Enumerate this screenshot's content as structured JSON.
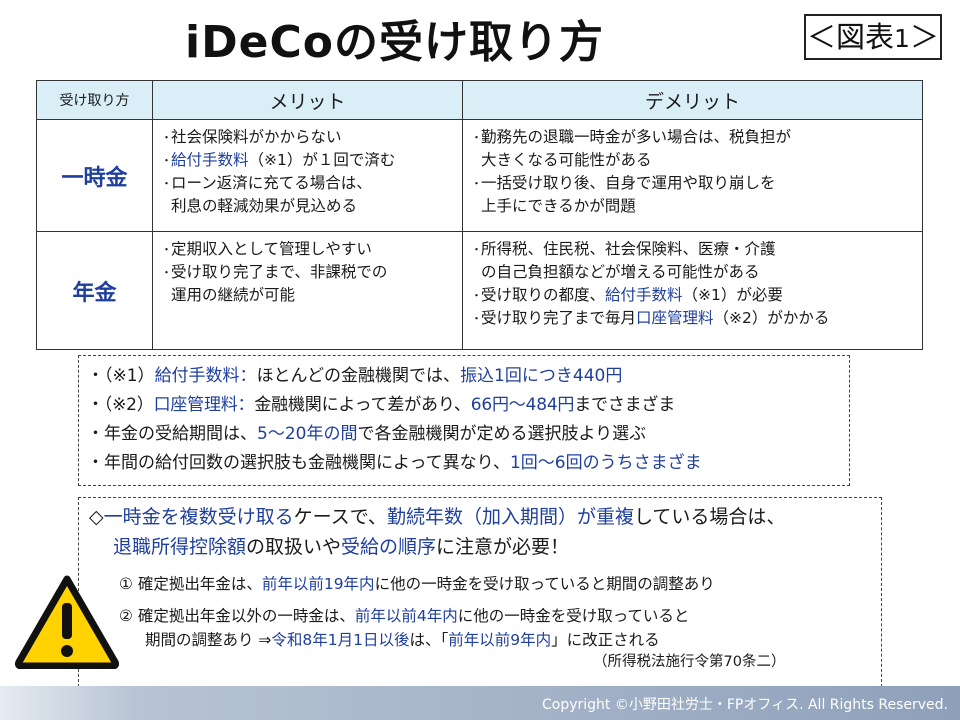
{
  "title": "iDeCoの受け取り方",
  "figure_label": {
    "open": "＜図表",
    "num": "1",
    "close": "＞"
  },
  "table": {
    "headers": [
      "受け取り方",
      "メリット",
      "デメリット"
    ],
    "rows": [
      {
        "label": "一時金",
        "merits": [
          {
            "parts": [
              {
                "text": "社会保険料がかからない"
              }
            ]
          },
          {
            "parts": [
              {
                "text": "給付手数料",
                "blue": true
              },
              {
                "text": "（※1）が１回で済む"
              }
            ]
          },
          {
            "parts": [
              {
                "text": "ローン返済に充てる場合は、"
              }
            ],
            "cont": "利息の軽減効果が見込める"
          }
        ],
        "demerits": [
          {
            "parts": [
              {
                "text": "勤務先の退職一時金が多い場合は、税負担が"
              }
            ],
            "cont": "大きくなる可能性がある"
          },
          {
            "parts": [
              {
                "text": "一括受け取り後、自身で運用や取り崩しを"
              }
            ],
            "cont": "上手にできるかが問題"
          }
        ]
      },
      {
        "label": "年金",
        "merits": [
          {
            "parts": [
              {
                "text": "定期収入として管理しやすい"
              }
            ]
          },
          {
            "parts": [
              {
                "text": "受け取り完了まで、非課税での"
              }
            ],
            "cont": "運用の継続が可能"
          }
        ],
        "demerits": [
          {
            "parts": [
              {
                "text": "所得税、住民税、社会保険料、医療・介護"
              }
            ],
            "cont": "の自己負担額などが増える可能性がある"
          },
          {
            "parts": [
              {
                "text": "受け取りの都度、"
              },
              {
                "text": "給付手数料",
                "blue": true
              },
              {
                "text": "（※1）が必要"
              }
            ]
          },
          {
            "parts": [
              {
                "text": "受け取り完了まで毎月"
              },
              {
                "text": "口座管理料",
                "blue": true
              },
              {
                "text": "（※2）がかかる"
              }
            ]
          }
        ]
      }
    ]
  },
  "notes": [
    [
      {
        "text": "・（※1）"
      },
      {
        "text": "給付手数料：",
        "blue": true
      },
      {
        "text": "ほとんどの金融機関では、"
      },
      {
        "text": "振込1回につき440円",
        "blue": true
      }
    ],
    [
      {
        "text": "・（※2）"
      },
      {
        "text": "口座管理料：",
        "blue": true
      },
      {
        "text": "金融機関によって差があり、"
      },
      {
        "text": "66円～484円",
        "blue": true
      },
      {
        "text": "までさまざま"
      }
    ],
    [
      {
        "text": "・年金の受給期間は、"
      },
      {
        "text": "5～20年の間",
        "blue": true
      },
      {
        "text": "で各金融機関が定める選択肢より選ぶ"
      }
    ],
    [
      {
        "text": "・年間の給付回数の選択肢も金融機関によって異なり、"
      },
      {
        "text": "1回～6回のうちさまざま",
        "blue": true
      }
    ]
  ],
  "caution": {
    "intro": [
      [
        {
          "text": "◇"
        },
        {
          "text": "一時金を複数受け取る",
          "blue": true
        },
        {
          "text": "ケースで、"
        },
        {
          "text": "勤続年数（加入期間）が重複",
          "blue": true
        },
        {
          "text": "している場合は、"
        }
      ],
      [
        {
          "text": "退職所得控除額",
          "blue": true
        },
        {
          "text": "の取扱いや"
        },
        {
          "text": "受給の順序",
          "blue": true
        },
        {
          "text": "に注意が必要！"
        }
      ]
    ],
    "items": [
      [
        {
          "text": "①  確定拠出年金は、"
        },
        {
          "text": "前年以前19年内",
          "blue": true
        },
        {
          "text": "に他の一時金を受け取っていると期間の調整あり"
        }
      ],
      [
        {
          "text": "②  確定拠出年金以外の一時金は、"
        },
        {
          "text": "前年以前4年内",
          "blue": true
        },
        {
          "text": "に他の一時金を受け取っていると"
        }
      ],
      [
        {
          "text": "期間の調整あり  ⇒"
        },
        {
          "text": "令和8年1月1日以後",
          "blue": true
        },
        {
          "text": "は、「"
        },
        {
          "text": "前年以前9年内",
          "blue": true
        },
        {
          "text": "」に改正される"
        }
      ]
    ],
    "source": "（所得税法施行令第70条二）"
  },
  "warning_icon": "warning-triangle-icon",
  "footer": {
    "copyright": "Copyright ©小野田社労士・FPオフィス. All Rights Reserved."
  },
  "colors": {
    "accent_blue": "#1f3f9e",
    "header_bg": "#daeef8",
    "warning_yellow": "#ffd200"
  }
}
